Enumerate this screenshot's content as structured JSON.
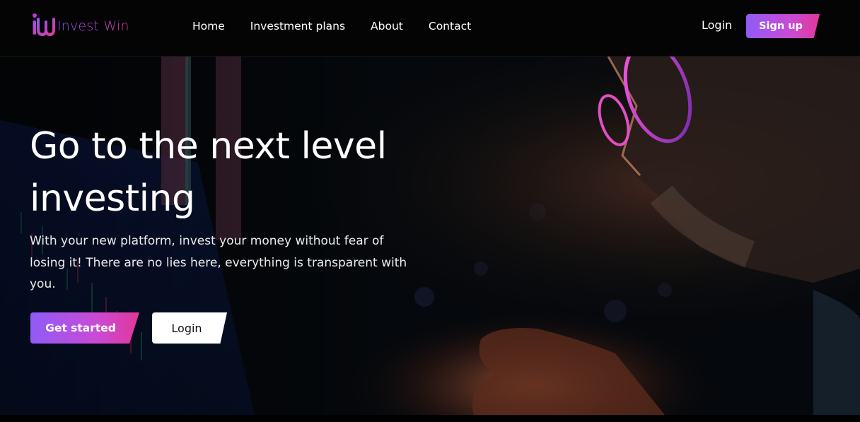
{
  "brand": {
    "name": "Invest Win"
  },
  "nav": {
    "links": [
      "Home",
      "Investment plans",
      "About",
      "Contact"
    ],
    "login_label": "Login",
    "signup_label": "Sign up"
  },
  "hero": {
    "headline": "Go to the next level investing",
    "subtext": "With your new platform, invest your money without fear of losing it! There are no lies here, everything is transparent with you.",
    "primary_cta": "Get started",
    "secondary_cta": "Login"
  },
  "colors": {
    "accent_start": "#8f5cf7",
    "accent_mid": "#c94ad6",
    "accent_end": "#e2389a",
    "background": "#040404"
  },
  "icons": {
    "logo": "invest-win-logo-icon"
  }
}
